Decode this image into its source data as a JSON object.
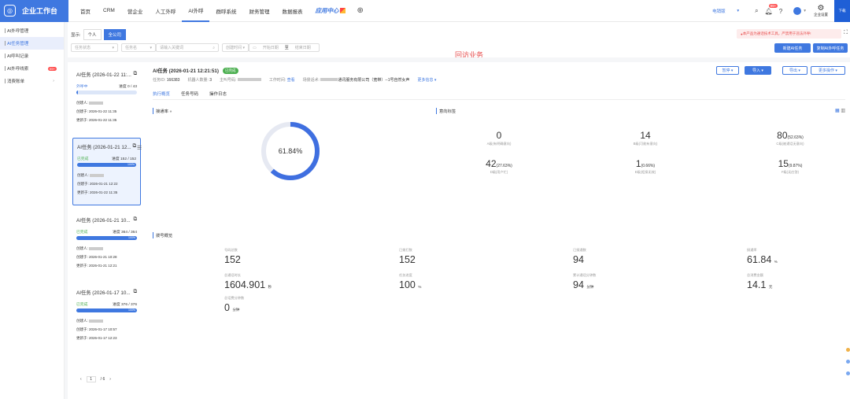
{
  "brand": {
    "name": "企业工作台"
  },
  "nav": {
    "items": [
      "首页",
      "CRM",
      "营企业",
      "人工外呼",
      "AI外呼",
      "群呼系统",
      "财务管理",
      "数据报表"
    ],
    "app_center": "应用中心"
  },
  "topright": {
    "select": "电销版",
    "bell_count": "99+",
    "settings": "企业设置",
    "corner": "下载"
  },
  "sidebar": {
    "items": [
      {
        "label": "AI外呼管理"
      },
      {
        "label": "AI任务管理"
      },
      {
        "label": "AI呼叫记录"
      },
      {
        "label": "AI外呼线索",
        "badge": "99+"
      },
      {
        "label": "消费账单"
      }
    ]
  },
  "toolbar": {
    "display_label": "显示:",
    "seg_personal": "个人",
    "seg_all": "全公司",
    "notice": "本产品为通话技术工具，严禁用于违法外呼!",
    "filter_status": "任务状态",
    "filter_name": "任务名",
    "search_placeholder": "请输入关键词",
    "filter_time": "创建时间",
    "start_date": "开始日期",
    "date_sep": "至",
    "end_date": "结束日期",
    "section_title": "回访业务",
    "new_task": "新建AI任务",
    "copy_task": "复制AI外呼任务"
  },
  "tasks": [
    {
      "title": "AI任务 (2026-01-22 11:...",
      "status": "外呼中",
      "progress_text": "进度 0 / 43",
      "progress": 0,
      "creator_label": "创建人:",
      "created_label": "创建于:",
      "created": "2026-01-22 11:35",
      "updated_label": "更新于:",
      "updated": "2026-01-22 11:35"
    },
    {
      "title": "AI任务 (2026-01-21 12...",
      "status": "已完成",
      "progress_text": "进度 152 / 152",
      "progress": 100,
      "creator_label": "创建人:",
      "created_label": "创建于:",
      "created": "2026-01-21 12:22",
      "updated_label": "更新于:",
      "updated": "2026-01-22 11:35"
    },
    {
      "title": "AI任务 (2026-01-21 10...",
      "status": "已完成",
      "progress_text": "进度 364 / 364",
      "progress": 100,
      "creator_label": "创建人:",
      "created_label": "创建于:",
      "created": "2026-01-21 10:28",
      "updated_label": "更新于:",
      "updated": "2026-01-21 12:21"
    },
    {
      "title": "AI任务 (2026-01-17 10...",
      "status": "已完成",
      "progress_text": "进度 376 / 376",
      "progress": 100,
      "creator_label": "创建人:",
      "created_label": "创建于:",
      "created": "2026-01-17 10:57",
      "updated_label": "更新于:",
      "updated": "2026-01-17 12:23"
    }
  ],
  "pager": {
    "prev": "‹",
    "page": "1",
    "total": "/ 6",
    "next": "›"
  },
  "detail": {
    "title": "AI任务 (2026-01-21 12:21:51)",
    "status": "已完成",
    "task_id_label": "任务ID:",
    "task_id": "166383",
    "robot_label": "机器人数量:",
    "robot": "3",
    "caller_label": "主叫号码:",
    "hours_label": "工作时间:",
    "hours": "查看",
    "tpl_label": "场景话术:",
    "tpl": "通讯服务有限公司（宽带）--1号自然女声",
    "more": "更多信息",
    "btn_pause": "暂停",
    "btn_import": "导入",
    "btn_export": "导出",
    "btn_more": "更多操作",
    "tabs": [
      "执行概览",
      "任务号码",
      "操作日志"
    ]
  },
  "connect": {
    "label": "接通率",
    "percent_text": "61.84%",
    "percent": 61.84
  },
  "intent": {
    "label": "意向标签",
    "stats": [
      {
        "value": "0",
        "pct": "",
        "label": "A级(有明确意向)"
      },
      {
        "value": "14",
        "pct": "",
        "label": "B级(可能有意向)"
      },
      {
        "value": "80",
        "pct": "(52.63%)",
        "label": "C级(被通话无意向)"
      },
      {
        "value": "42",
        "pct": "(27.63%)",
        "label": "D级(用户忙)"
      },
      {
        "value": "1",
        "pct": "(0.66%)",
        "label": "E级(拒接无效)"
      },
      {
        "value": "15",
        "pct": "(9.87%)",
        "label": "F级(无应答)"
      }
    ]
  },
  "overview": {
    "label": "拨号概览",
    "items": [
      {
        "label": "号码总数",
        "value": "152",
        "unit": ""
      },
      {
        "label": "已拨打数",
        "value": "152",
        "unit": ""
      },
      {
        "label": "已接通数",
        "value": "94",
        "unit": ""
      },
      {
        "label": "接通率",
        "value": "61.84",
        "unit": "%"
      },
      {
        "label": "总通话时长",
        "value": "1604.901",
        "unit": "秒"
      },
      {
        "label": "任务进度",
        "value": "100",
        "unit": "%"
      },
      {
        "label": "累计通话分钟数",
        "value": "94",
        "unit": "分钟"
      },
      {
        "label": "总消费金额",
        "value": "14.1",
        "unit": "元"
      },
      {
        "label": "总话费分钟数",
        "value": "0",
        "unit": "分钟"
      }
    ]
  },
  "colors": {
    "accent": "#3f78e0",
    "success": "#4caf50",
    "danger": "#e74c4c"
  }
}
